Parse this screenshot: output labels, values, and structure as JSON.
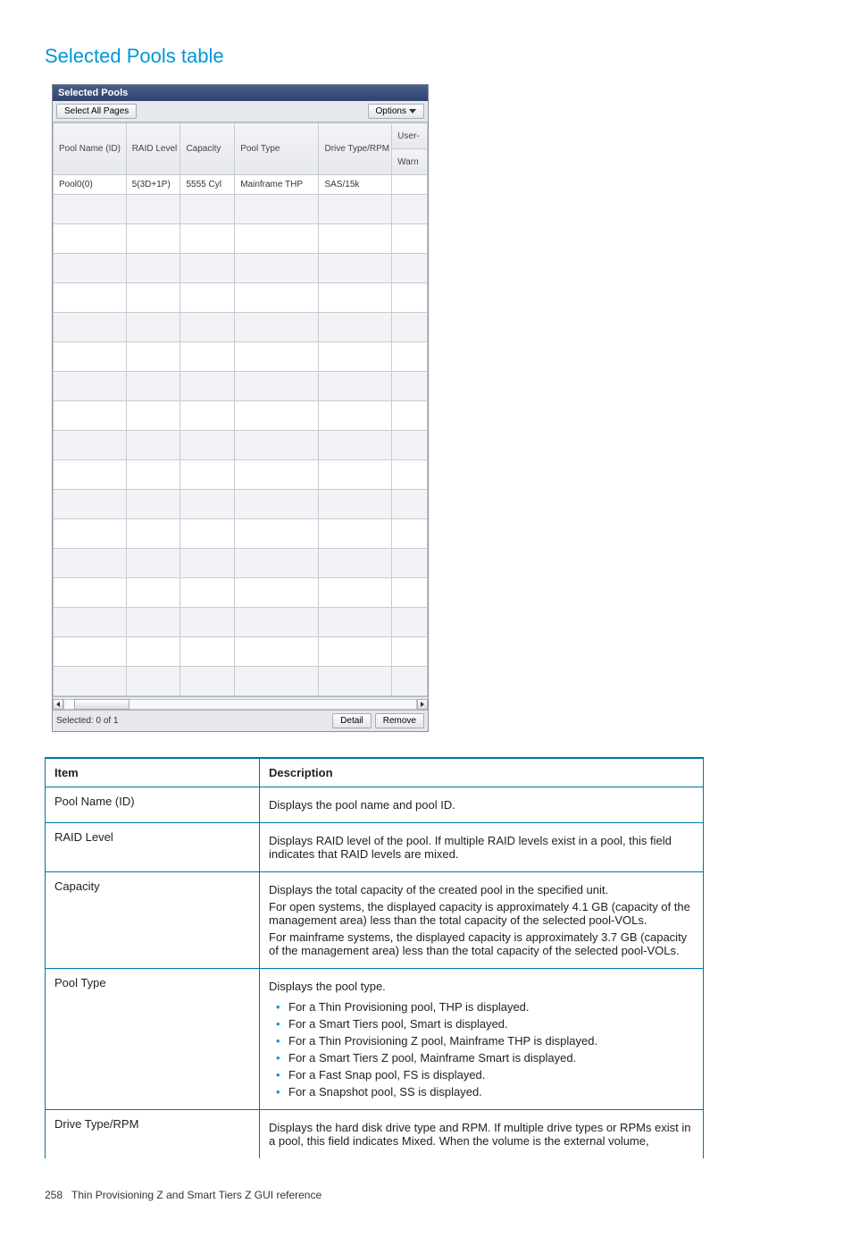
{
  "title": "Selected Pools table",
  "panel": {
    "header": "Selected Pools",
    "select_all": "Select All Pages",
    "options": "Options",
    "columns": {
      "pool_name": "Pool Name (ID)",
      "raid": "RAID Level",
      "capacity": "Capacity",
      "pool_type": "Pool Type",
      "drive": "Drive Type/RPM",
      "user_top": "User-",
      "user_bot": "Warn"
    },
    "row": {
      "pool_name": "Pool0(0)",
      "raid": "5(3D+1P)",
      "capacity": "5555 Cyl",
      "pool_type": "Mainframe THP",
      "drive": "SAS/15k"
    },
    "footer": {
      "selected": "Selected:  0   of  1",
      "detail": "Detail",
      "remove": "Remove"
    }
  },
  "desc": {
    "head_item": "Item",
    "head_desc": "Description",
    "rows": [
      {
        "item": "Pool Name (ID)",
        "paras": [
          "Displays the pool name and pool ID."
        ]
      },
      {
        "item": "RAID Level",
        "paras": [
          "Displays RAID level of the pool. If multiple RAID levels exist in a pool, this field indicates that RAID levels are mixed."
        ]
      },
      {
        "item": "Capacity",
        "paras": [
          "Displays the total capacity of the created pool in the specified unit.",
          "For open systems, the displayed capacity is approximately 4.1 GB (capacity of the management area) less than the total capacity of the selected pool-VOLs.",
          "For mainframe systems, the displayed capacity is approximately 3.7 GB (capacity of the management area) less than the total capacity of the selected pool-VOLs."
        ]
      },
      {
        "item": "Pool Type",
        "paras": [
          "Displays the pool type."
        ],
        "bullets": [
          "For a Thin Provisioning pool, THP is displayed.",
          "For a Smart Tiers pool, Smart is displayed.",
          "For a Thin Provisioning Z pool, Mainframe THP is displayed.",
          "For a Smart Tiers Z pool, Mainframe Smart is displayed.",
          "For a Fast Snap pool, FS is displayed.",
          "For a Snapshot pool, SS is displayed."
        ]
      },
      {
        "item": "Drive Type/RPM",
        "paras": [
          "Displays the hard disk drive type and RPM. If multiple drive types or RPMs exist in a pool, this field indicates Mixed. When the volume is the external volume,"
        ]
      }
    ]
  },
  "footer": {
    "page": "258",
    "label": "Thin Provisioning Z and Smart Tiers Z GUI reference"
  }
}
